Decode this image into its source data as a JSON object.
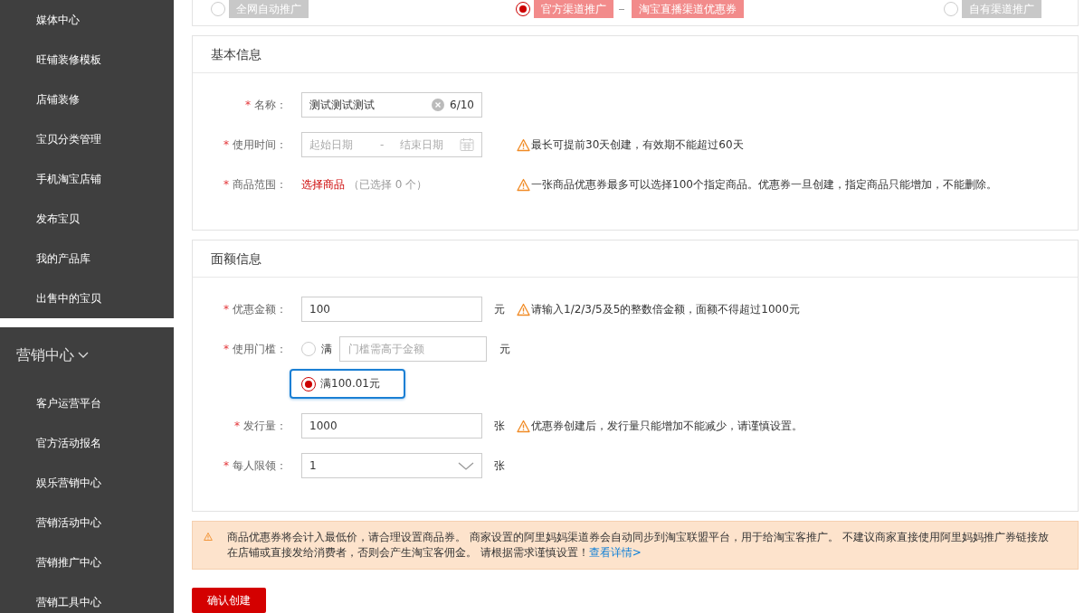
{
  "sidebar": {
    "sections": [
      {
        "items": [
          "媒体中心",
          "旺铺装修模板",
          "店铺装修",
          "宝贝分类管理",
          "手机淘宝店铺",
          "发布宝贝",
          "我的产品库",
          "出售中的宝贝"
        ]
      },
      {
        "title": "营销中心",
        "expanded": true,
        "items": [
          "客户运营平台",
          "官方活动报名",
          "娱乐营销中心",
          "营销活动中心",
          "营销推广中心",
          "营销工具中心"
        ]
      }
    ]
  },
  "promotion_types": [
    {
      "selected": false,
      "tags": [
        "全网自动推广"
      ]
    },
    {
      "selected": true,
      "tags": [
        "官方渠道推广",
        "淘宝直播渠道优惠券"
      ]
    },
    {
      "selected": false,
      "tags": [
        "自有渠道推广"
      ]
    }
  ],
  "basic_info": {
    "title": "基本信息",
    "fields": [
      {
        "kind": "text",
        "required_mark": "*",
        "label": "名称：",
        "value": "测试测试测试",
        "counter": "6/10"
      },
      {
        "kind": "daterange",
        "required_mark": "*",
        "label": "使用时间：",
        "start_placeholder": "起始日期",
        "separator": "-",
        "end_placeholder": "结束日期",
        "hint": "最长可提前30天创建，有效期不能超过60天"
      },
      {
        "kind": "link",
        "required_mark": "*",
        "label": "商品范围：",
        "link": "选择商品",
        "note": "（已选择 0 个）",
        "hint": "一张商品优惠券最多可以选择100个指定商品。优惠券一旦创建，指定商品只能增加，不能删除。"
      }
    ]
  },
  "amount_info": {
    "title": "面额信息",
    "fields": [
      {
        "kind": "text",
        "required_mark": "*",
        "label": "优惠金额：",
        "value": "100",
        "unit": "元",
        "hint": "请输入1/2/3/5及5的整数倍金额，面额不得超过1000元"
      },
      {
        "kind": "threshold",
        "required_mark": "*",
        "label": "使用门槛：",
        "options": [
          {
            "kind": "input",
            "selected": false,
            "prefix": "满",
            "placeholder": "门槛需高于金额",
            "unit": "元"
          },
          {
            "kind": "fixed",
            "selected": true,
            "focused": true,
            "text": "满100.01元"
          }
        ]
      },
      {
        "kind": "text",
        "required_mark": "*",
        "label": "发行量：",
        "value": "1000",
        "unit": "张",
        "hint": "优惠券创建后，发行量只能增加不能减少，请谨慎设置。"
      },
      {
        "kind": "select",
        "required_mark": "*",
        "label": "每人限领：",
        "value": "1",
        "unit": "张"
      }
    ]
  },
  "notice": {
    "text": "商品优惠券将会计入最低价，请合理设置商品券。 商家设置的阿里妈妈渠道券会自动同步到淘宝联盟平台，用于给淘宝客推广。 不建议商家直接使用阿里妈妈推广券链接放在店铺或直接发给消费者，否则会产生淘宝客佣金。 请根据需求谨慎设置！",
    "link": "查看详情>"
  },
  "submit_button": "确认创建"
}
